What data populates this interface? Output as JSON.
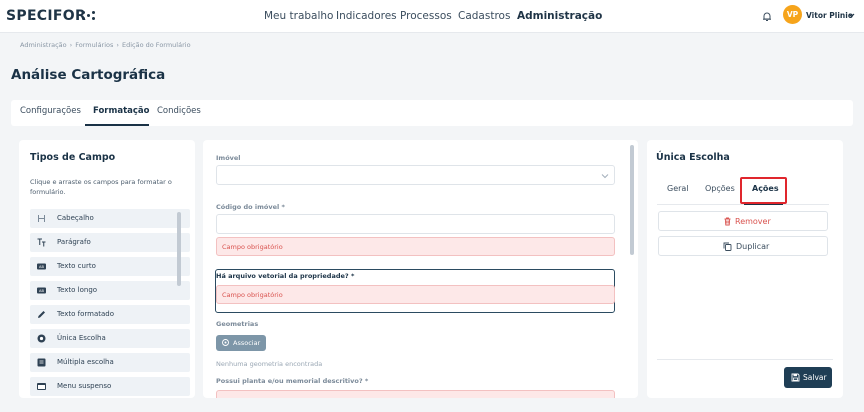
{
  "header": {
    "logo_text": "SPECIFOR",
    "nav": [
      "Meu trabalho",
      "Indicadores",
      "Processos",
      "Cadastros",
      "Administração"
    ],
    "active_nav": "Administração",
    "user": {
      "initials": "VP",
      "name": "Vitor Plinio"
    }
  },
  "breadcrumb": [
    "Administração",
    "Formulários",
    "Edição do Formulário"
  ],
  "page_title": "Análise Cartográfica",
  "tabs": [
    "Configurações",
    "Formatação",
    "Condições"
  ],
  "active_tab": "Formatação",
  "left_panel": {
    "title": "Tipos de Campo",
    "help": "Clique e arraste os campos para formatar o formulário.",
    "items": [
      {
        "label": "Cabeçalho",
        "icon": "heading-icon"
      },
      {
        "label": "Parágrafo",
        "icon": "paragraph-icon"
      },
      {
        "label": "Texto curto",
        "icon": "short-text-icon"
      },
      {
        "label": "Texto longo",
        "icon": "long-text-icon"
      },
      {
        "label": "Texto formatado",
        "icon": "pen-icon"
      },
      {
        "label": "Única Escolha",
        "icon": "radio-icon"
      },
      {
        "label": "Múltipla escolha",
        "icon": "checkbox-icon"
      },
      {
        "label": "Menu suspenso",
        "icon": "dropdown-menu-icon"
      }
    ]
  },
  "form": {
    "imovel_label": "Imóvel",
    "codigo_label": "Código do imóvel *",
    "error_text": "Campo obrigatório",
    "vetorial_label": "Há arquivo vetorial da propriedade? *",
    "geometrias_label": "Geometrias",
    "associar_label": "Associar",
    "no_geometry": "Nenhuma geometria encontrada",
    "planta_label": "Possui planta e/ou memorial descritivo? *"
  },
  "right_panel": {
    "title": "Única Escolha",
    "tabs": [
      "Geral",
      "Opções",
      "Ações"
    ],
    "active_tab": "Ações",
    "remove_label": "Remover",
    "duplicate_label": "Duplicar",
    "save_label": "Salvar"
  },
  "colors": {
    "primary": "#1f3e55",
    "avatar": "#f6a41b",
    "error": "#d9534f",
    "highlight": "#e0262d"
  }
}
